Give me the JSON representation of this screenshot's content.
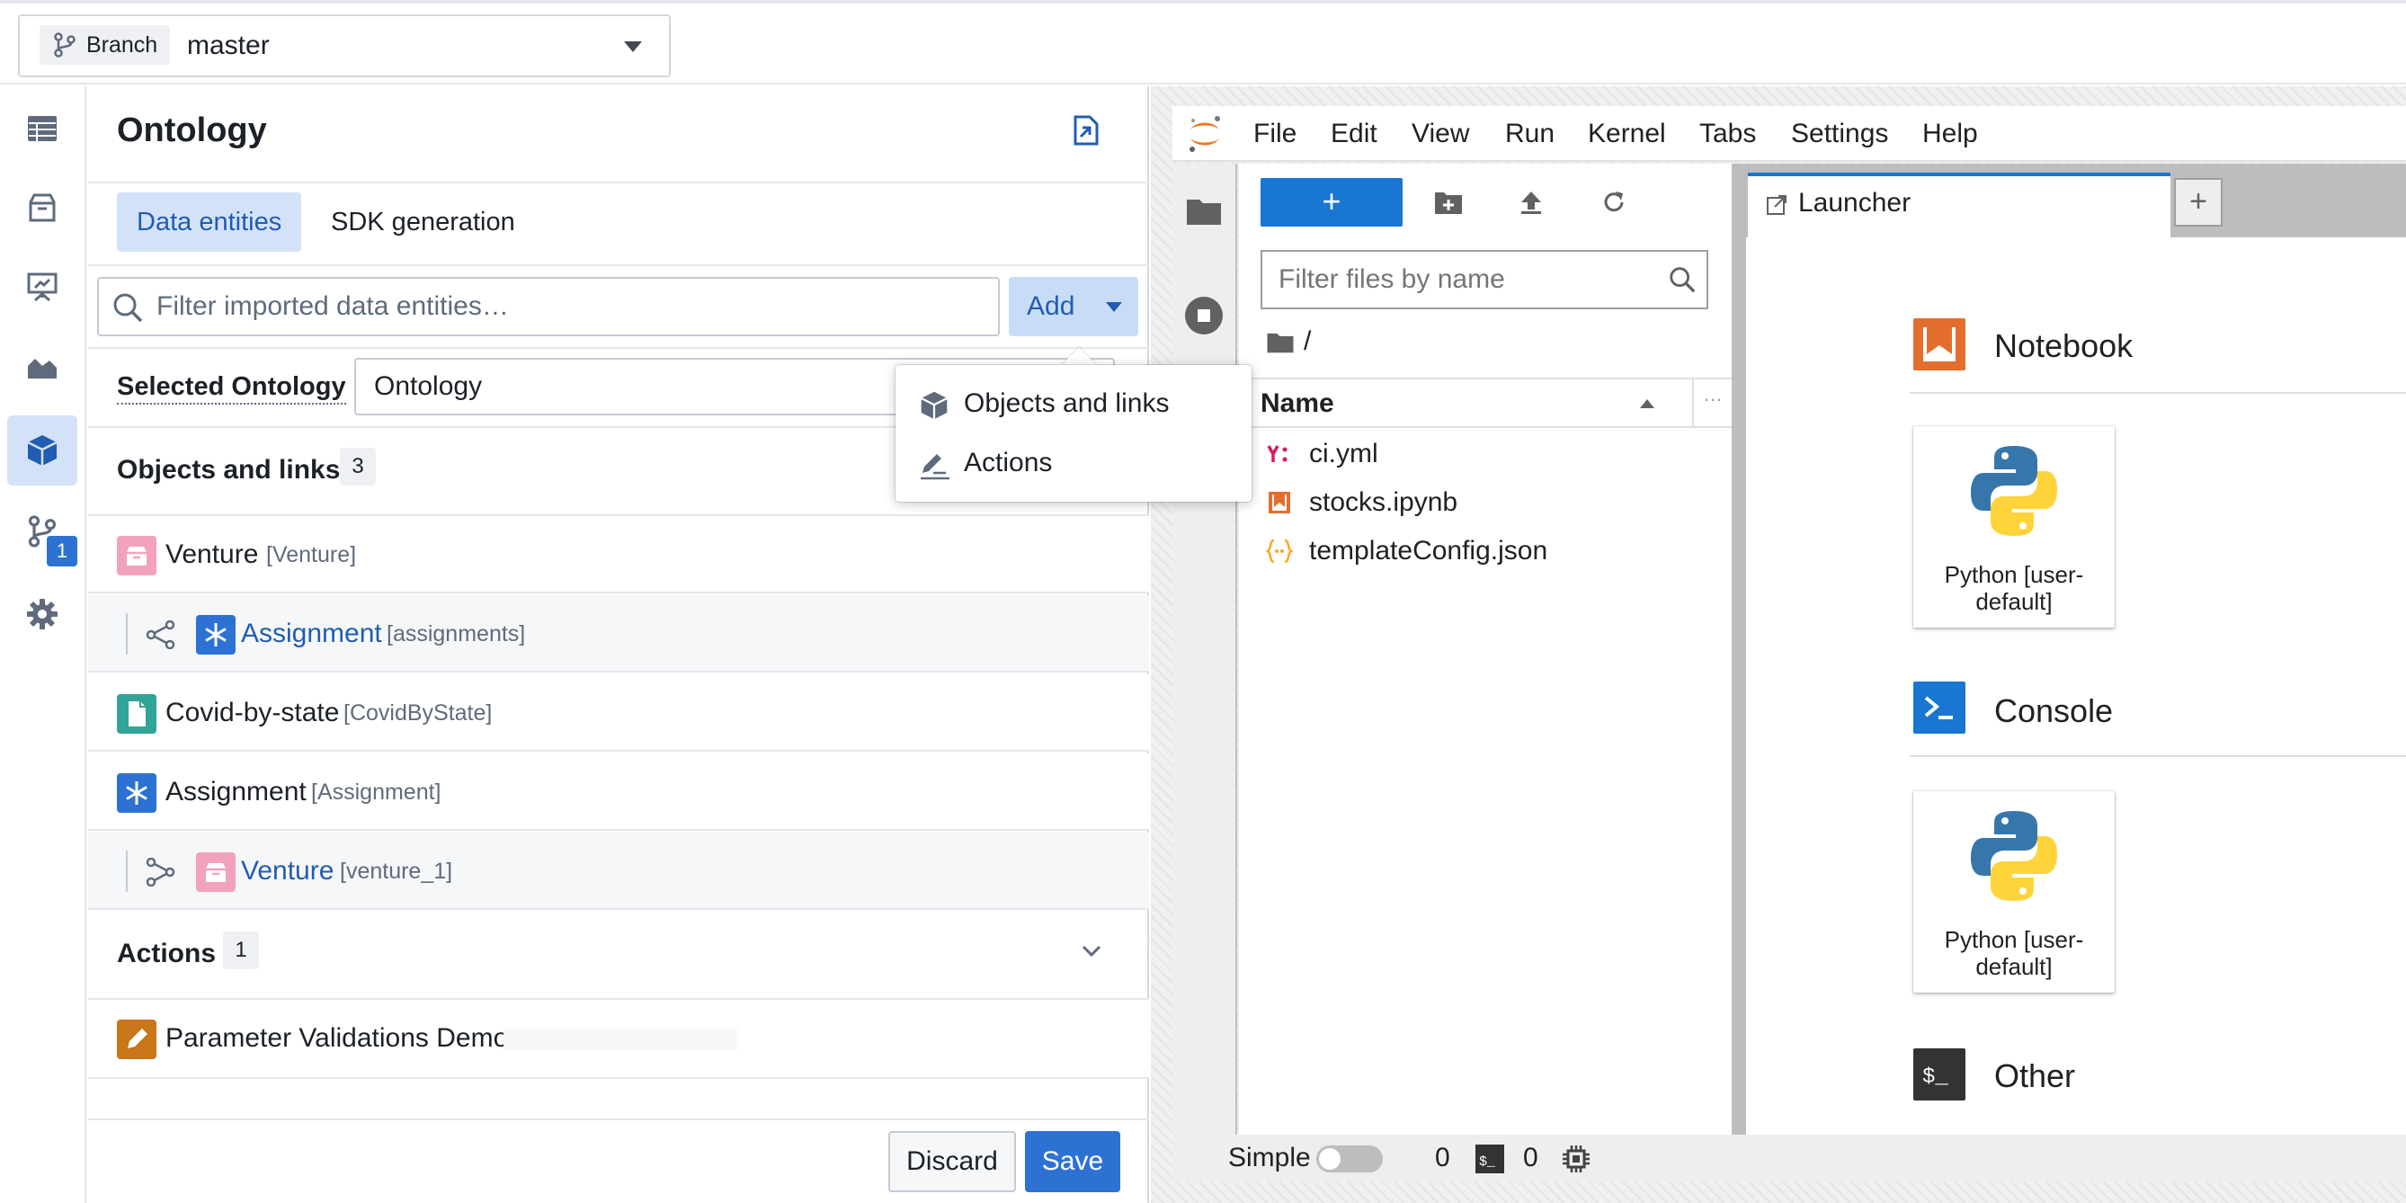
{
  "branch": {
    "tag": "Branch",
    "value": "master"
  },
  "rail": {
    "badge": "1"
  },
  "ontology": {
    "title": "Ontology",
    "tabs": [
      "Data entities",
      "SDK generation"
    ],
    "filter_placeholder": "Filter imported data entities…",
    "add_label": "Add",
    "selected_label": "Selected Ontology",
    "selected_value": "Ontology",
    "objects_section": {
      "title": "Objects and links",
      "count": "3"
    },
    "rows": [
      {
        "name": "Venture",
        "api": "[Venture]",
        "icon": "object-pink-icon"
      },
      {
        "name": "Assignment",
        "api": "[assignments]",
        "icon": "object-blue-icon",
        "link": true
      },
      {
        "name": "Covid-by-state",
        "api": "[CovidByState]",
        "icon": "object-green-icon"
      },
      {
        "name": "Assignment",
        "api": "[Assignment]",
        "icon": "object-blue-icon"
      },
      {
        "name": "Venture",
        "api": "[venture_1]",
        "icon": "object-pink-icon",
        "link": true
      }
    ],
    "actions_section": {
      "title": "Actions",
      "count": "1"
    },
    "action_row": {
      "name": "Parameter Validations Demo"
    },
    "discard_label": "Discard",
    "save_label": "Save"
  },
  "add_menu": {
    "items": [
      "Objects and links",
      "Actions"
    ]
  },
  "jupyter": {
    "menus": [
      "File",
      "Edit",
      "View",
      "Run",
      "Kernel",
      "Tabs",
      "Settings",
      "Help"
    ],
    "new_button": "+",
    "file_filter_placeholder": "Filter files by name",
    "path": "/",
    "column_name": "Name",
    "files": [
      {
        "name": "ci.yml",
        "icon": "yaml-icon"
      },
      {
        "name": "stocks.ipynb",
        "icon": "notebook-file-icon"
      },
      {
        "name": "templateConfig.json",
        "icon": "json-icon"
      }
    ],
    "tab_label": "Launcher",
    "new_tab": "+",
    "launcher": {
      "sections": [
        {
          "title": "Notebook",
          "card": "Python [user-\ndefault]"
        },
        {
          "title": "Console",
          "card": "Python [user-\ndefault]"
        },
        {
          "title": "Other"
        }
      ]
    },
    "status": {
      "mode": "Simple",
      "kernels": "0",
      "terminals": "0"
    },
    "colors": {
      "accent": "#1976d2",
      "notebook": "#e46e2e",
      "console": "#1976d2",
      "other": "#333333"
    }
  },
  "colors": {
    "primary": "#2d72d2",
    "active_tab_bg": "#d3e2f8",
    "link": "#215db0"
  }
}
